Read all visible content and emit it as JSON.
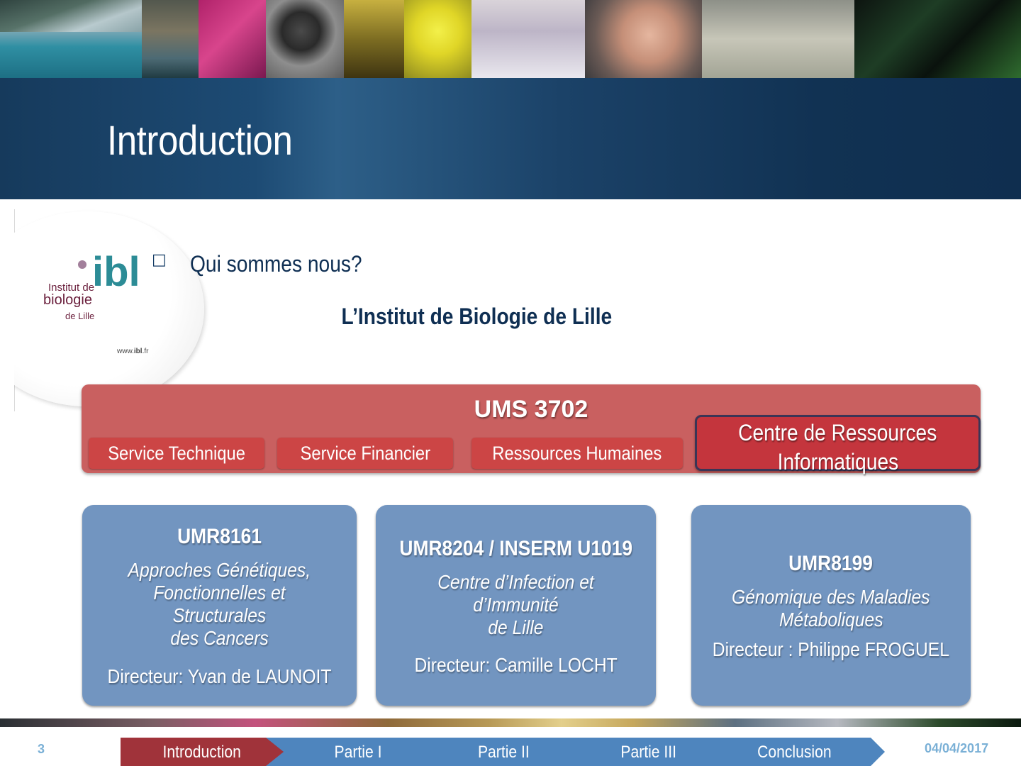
{
  "slide": {
    "title": "Introduction",
    "question": "Qui sommes nous?",
    "institute": "L’Institut de Biologie de Lille",
    "bullet_icon": "wingdings-bullet-icon"
  },
  "logo": {
    "mark": "ibl",
    "line1": "Institut de",
    "line2": "biologie",
    "line3": "de Lille",
    "url_prefix": "www.",
    "url_bold": "ibl",
    "url_suffix": ".fr",
    "colors": {
      "dot": "#a27f9b",
      "ib": "#2c8c96",
      "l": "#7f93b5",
      "text": "#6a1f3c"
    }
  },
  "ums": {
    "title": "UMS 3702",
    "services": [
      "Service Technique",
      "Service Financier",
      "Ressources Humaines"
    ],
    "cri_line1": "Centre de Ressources",
    "cri_line2": "Informatiques"
  },
  "units": [
    {
      "code": "UMR8161",
      "desc_line1": "Approches Génétiques,",
      "desc_line2": "Fonctionnelles et Structurales",
      "desc_line3": "des Cancers",
      "director": "Directeur: Yvan de LAUNOIT"
    },
    {
      "code": "UMR8204 / INSERM U1019",
      "desc_line1": "Centre d’Infection et d’Immunité",
      "desc_line2": "de Lille",
      "director": "Directeur: Camille LOCHT"
    },
    {
      "code": "UMR8199",
      "desc_line1": "Génomique des Maladies",
      "desc_line2": "Métaboliques",
      "director": "Directeur : Philippe FROGUEL"
    }
  ],
  "footer": {
    "page_number": "3",
    "date": "04/04/2017",
    "nav": [
      "Introduction",
      "Partie I",
      "Partie II",
      "Partie III",
      "Conclusion"
    ],
    "active_nav": "Introduction"
  },
  "colors": {
    "title_band": "#1b4268",
    "ums_block": "#c96060",
    "service_button": "#cc4545",
    "cri_box": "#c4353d",
    "umr_card": "#7295c0",
    "nav_active": "#a0333a",
    "nav_inactive": "#4e85be",
    "accent_text": "#7ab0d6"
  }
}
